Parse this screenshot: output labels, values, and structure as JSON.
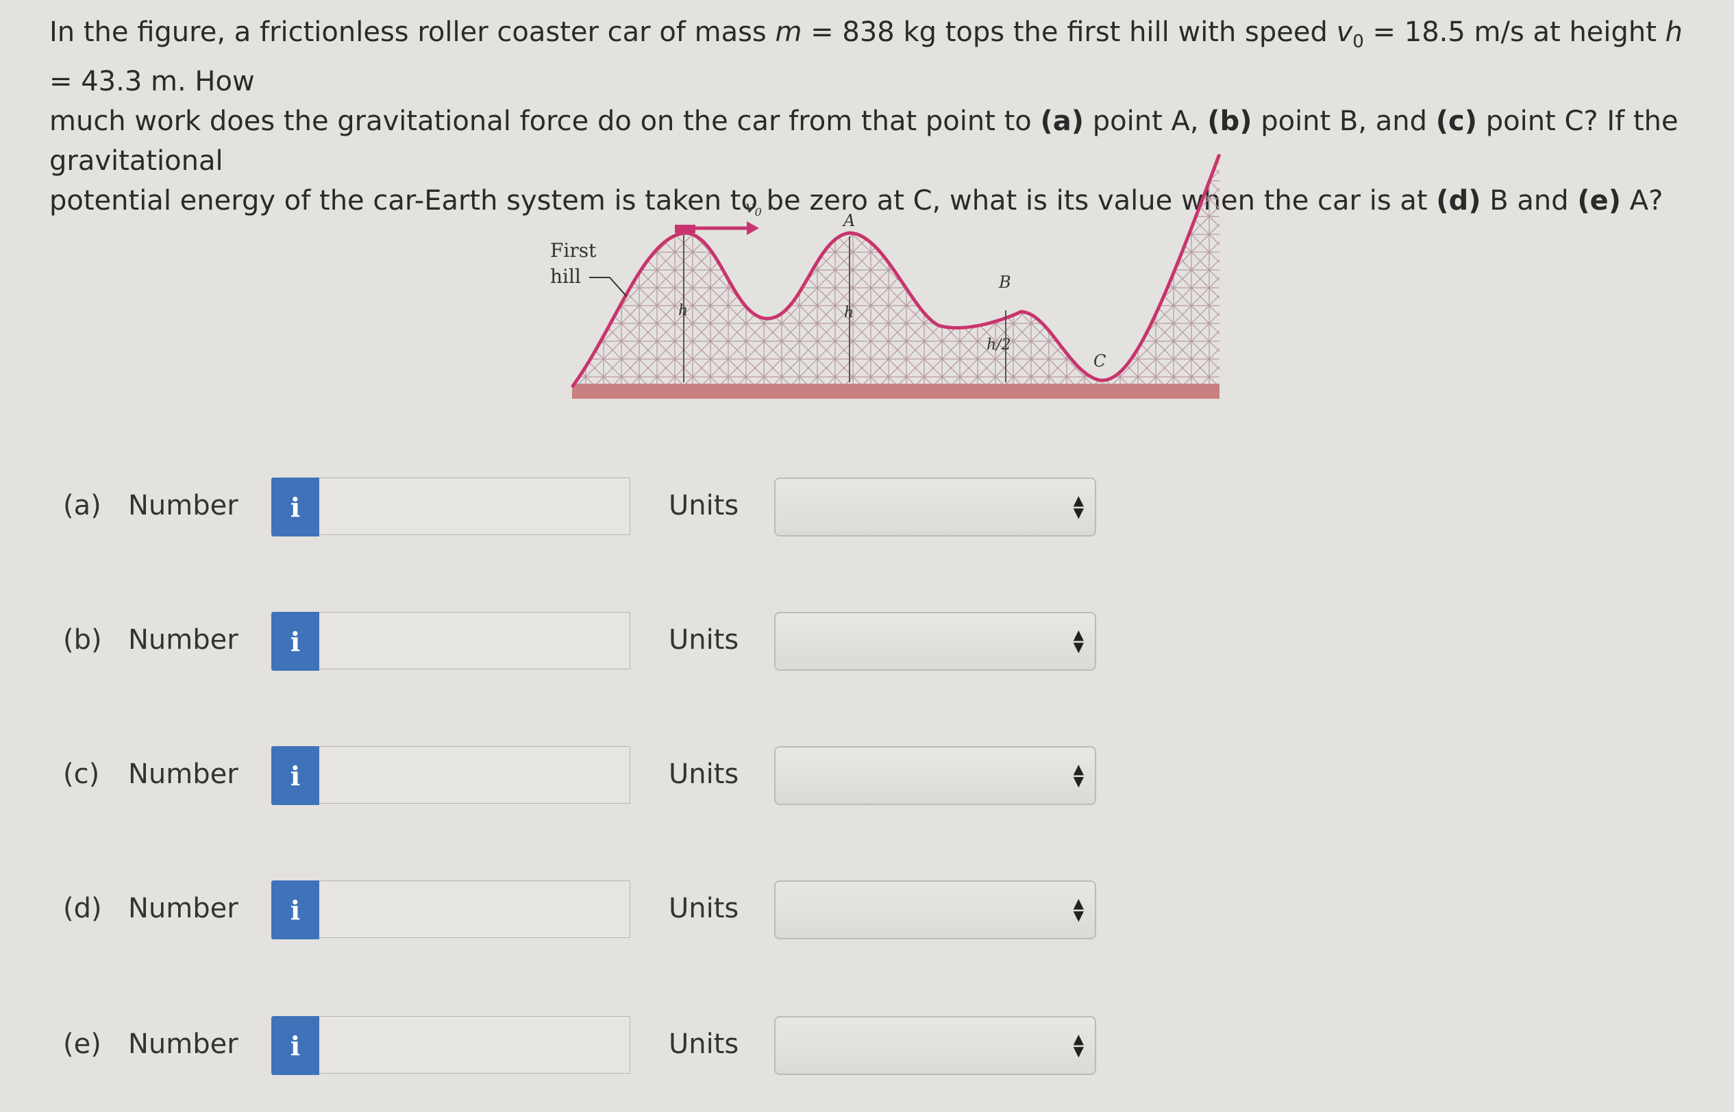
{
  "question": {
    "line1_a": "In the figure, a frictionless roller coaster car of mass ",
    "m_sym": "m",
    "line1_b": " = 838 kg tops the first hill with speed ",
    "v0_sym": "v",
    "v0_sub": "0",
    "line1_c": " = 18.5 m/s at height ",
    "h_sym": "h",
    "line1_d": " = 43.3 m. How",
    "line2_a": "much work does the gravitational force do on the car from that point to ",
    "a_tag": "(a)",
    "pointA": " point A, ",
    "b_tag": "(b)",
    "pointB": " point B, and ",
    "c_tag": "(c)",
    "pointC": " point C? If the gravitational",
    "line3_a": "potential energy of the car-Earth system is taken to be zero at C, what is its value when the car is at ",
    "d_tag": "(d)",
    "d_text": " B and ",
    "e_tag": "(e)",
    "e_text": " A?"
  },
  "figure": {
    "first_hill_line1": "First",
    "first_hill_line2": "hill",
    "v0_label": "v",
    "v0_sub": "0",
    "label_A": "A",
    "label_B": "B",
    "label_C": "C",
    "label_h1": "h",
    "label_h2": "h",
    "label_h_half": "h/2",
    "track_color": "#c8356e",
    "ground_color": "#c98080"
  },
  "rows": [
    {
      "part": "(a)",
      "label": "Number",
      "info": "i",
      "value": "",
      "units_label": "Units",
      "units_value": ""
    },
    {
      "part": "(b)",
      "label": "Number",
      "info": "i",
      "value": "",
      "units_label": "Units",
      "units_value": ""
    },
    {
      "part": "(c)",
      "label": "Number",
      "info": "i",
      "value": "",
      "units_label": "Units",
      "units_value": ""
    },
    {
      "part": "(d)",
      "label": "Number",
      "info": "i",
      "value": "",
      "units_label": "Units",
      "units_value": ""
    },
    {
      "part": "(e)",
      "label": "Number",
      "info": "i",
      "value": "",
      "units_label": "Units",
      "units_value": ""
    }
  ],
  "colors": {
    "info_button": "#3f72b8",
    "background": "#e4e2de"
  }
}
